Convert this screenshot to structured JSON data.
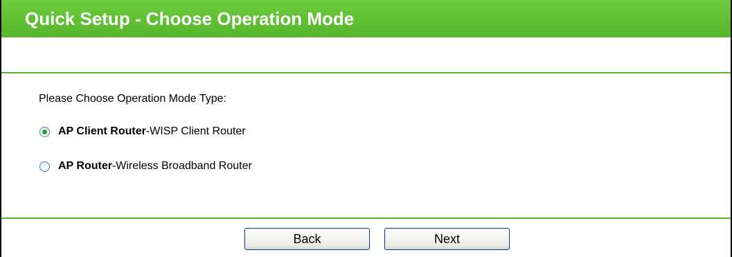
{
  "header": {
    "title": "Quick Setup - Choose Operation Mode"
  },
  "form": {
    "prompt": "Please Choose Operation Mode Type:",
    "options": [
      {
        "name": "AP Client Router",
        "separator": " - ",
        "description": "WISP Client Router",
        "selected": true
      },
      {
        "name": "AP Router",
        "separator": " - ",
        "description": "Wireless Broadband Router",
        "selected": false
      }
    ]
  },
  "buttons": {
    "back_label": "Back",
    "next_label": "Next"
  },
  "colors": {
    "header": "#5cbb31",
    "rule": "#59b52f",
    "radio_checked": "#21a121"
  }
}
